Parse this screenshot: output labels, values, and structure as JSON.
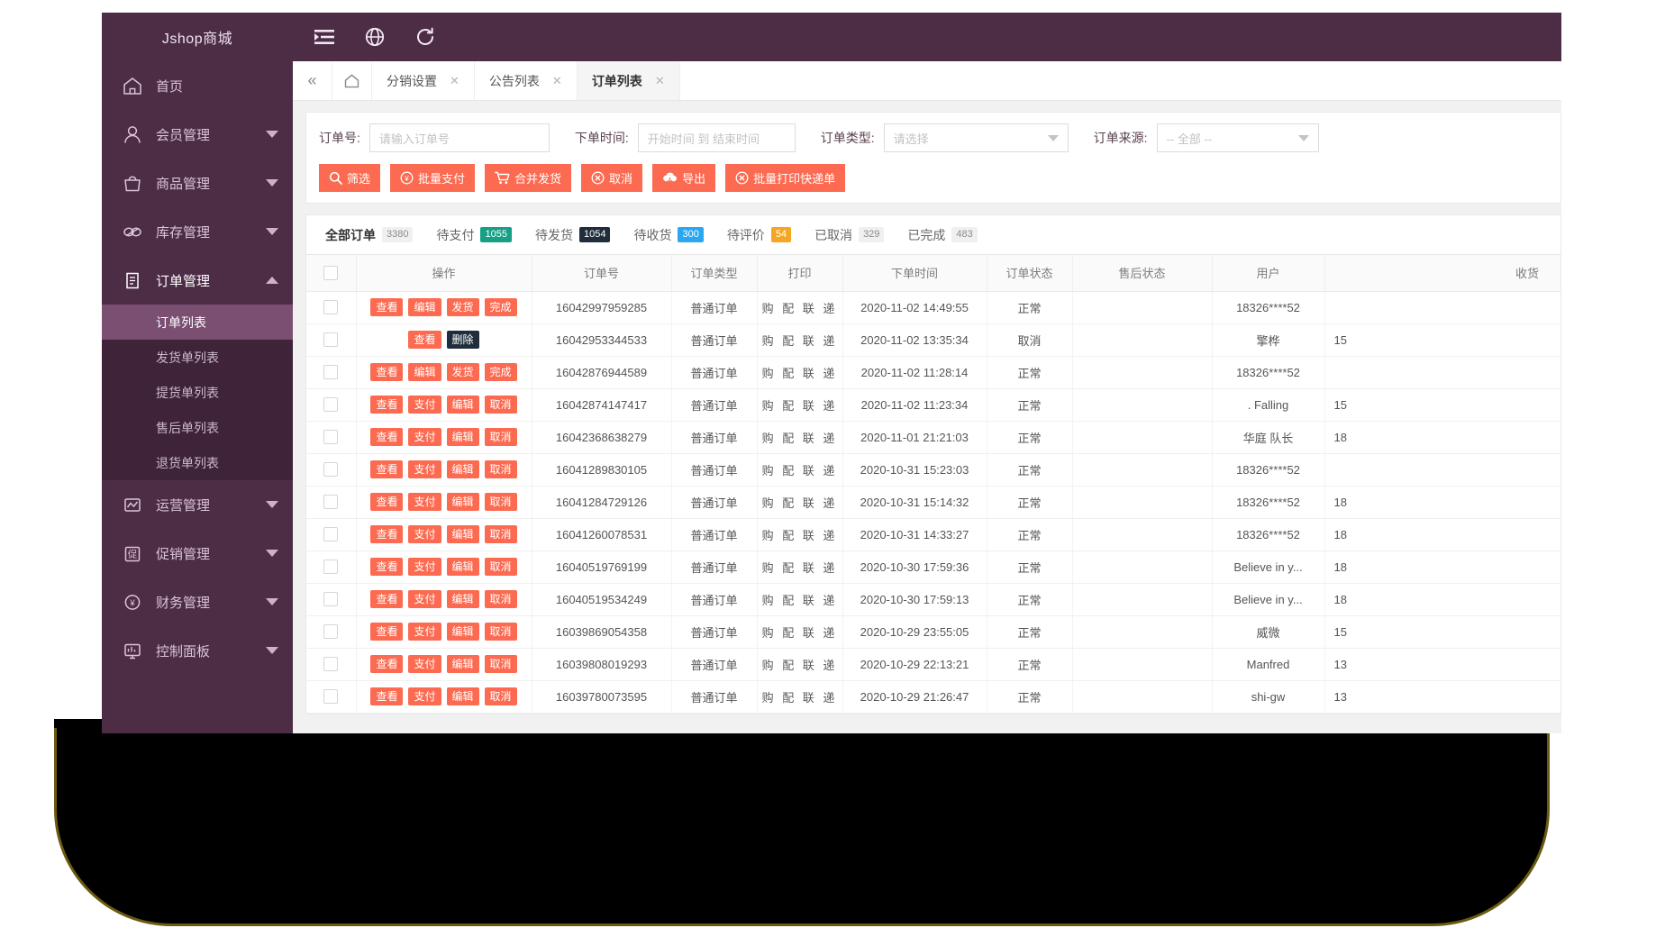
{
  "brand": {
    "title": "Jshop商城"
  },
  "topbar": {
    "icons": [
      {
        "name": "menu-collapse-icon",
        "glyph": "menu"
      },
      {
        "name": "language-globe-icon",
        "glyph": "globe"
      },
      {
        "name": "refresh-icon",
        "glyph": "refresh"
      }
    ]
  },
  "sidebar": {
    "items": [
      {
        "label": "首页",
        "icon": "home-icon",
        "expandable": false
      },
      {
        "label": "会员管理",
        "icon": "user-icon",
        "expandable": true
      },
      {
        "label": "商品管理",
        "icon": "bag-icon",
        "expandable": true
      },
      {
        "label": "库存管理",
        "icon": "link-icon",
        "expandable": true
      },
      {
        "label": "订单管理",
        "icon": "clipboard-icon",
        "expandable": true,
        "open": true
      },
      {
        "label": "运营管理",
        "icon": "chart-board-icon",
        "expandable": true
      },
      {
        "label": "促销管理",
        "icon": "promo-icon",
        "expandable": true
      },
      {
        "label": "财务管理",
        "icon": "finance-icon",
        "expandable": true
      },
      {
        "label": "控制面板",
        "icon": "dashboard-icon",
        "expandable": true
      }
    ],
    "order_submenu": [
      {
        "label": "订单列表",
        "active": true
      },
      {
        "label": "发货单列表",
        "active": false
      },
      {
        "label": "提货单列表",
        "active": false
      },
      {
        "label": "售后单列表",
        "active": false
      },
      {
        "label": "退货单列表",
        "active": false
      }
    ]
  },
  "navtabs": {
    "collapse_glyph": "«",
    "home_glyph": "⌂",
    "tabs": [
      {
        "label": "分销设置",
        "active": false,
        "closable": true
      },
      {
        "label": "公告列表",
        "active": false,
        "closable": true
      },
      {
        "label": "订单列表",
        "active": true,
        "closable": true
      }
    ],
    "close_glyph": "✕"
  },
  "filter": {
    "order_no": {
      "label": "订单号:",
      "placeholder": "请输入订单号",
      "value": ""
    },
    "order_time": {
      "label": "下单时间:",
      "placeholder": "开始时间 到 结束时间",
      "value": ""
    },
    "order_type": {
      "label": "订单类型:",
      "placeholder": "请选择",
      "value": ""
    },
    "order_source": {
      "label": "订单来源:",
      "placeholder": "-- 全部 --",
      "value": ""
    },
    "buttons": [
      {
        "label": "筛选",
        "icon": "search-icon"
      },
      {
        "label": "批量支付",
        "icon": "yuan-circle-icon"
      },
      {
        "label": "合并发货",
        "icon": "cart-icon"
      },
      {
        "label": "取消",
        "icon": "close-circle-icon"
      },
      {
        "label": "导出",
        "icon": "cloud-download-icon"
      },
      {
        "label": "批量打印快递单",
        "icon": "close-circle-icon"
      }
    ],
    "accent_color": "#fc6b51"
  },
  "status_tabs": [
    {
      "label": "全部订单",
      "count": "3380",
      "badge_color": "#f0f0f0",
      "badge_text_color": "#8c8c8c",
      "active": true
    },
    {
      "label": "待支付",
      "count": "1055",
      "badge_color": "#16a085",
      "badge_text_color": "#ffffff",
      "active": false
    },
    {
      "label": "待发货",
      "count": "1054",
      "badge_color": "#1f2d3d",
      "badge_text_color": "#ffffff",
      "active": false
    },
    {
      "label": "待收货",
      "count": "300",
      "badge_color": "#2aa7f0",
      "badge_text_color": "#ffffff",
      "active": false
    },
    {
      "label": "待评价",
      "count": "54",
      "badge_color": "#f5a623",
      "badge_text_color": "#ffffff",
      "active": false
    },
    {
      "label": "已取消",
      "count": "329",
      "badge_color": "#f0f0f0",
      "badge_text_color": "#8c8c8c",
      "active": false
    },
    {
      "label": "已完成",
      "count": "483",
      "badge_color": "#f0f0f0",
      "badge_text_color": "#8c8c8c",
      "active": false
    }
  ],
  "table": {
    "columns": [
      "",
      "操作",
      "订单号",
      "订单类型",
      "打印",
      "下单时间",
      "订单状态",
      "售后状态",
      "用户",
      "收货"
    ],
    "print_cell": "购 配 联 递",
    "rows": [
      {
        "ops": [
          "查看",
          "编辑",
          "发货",
          "完成"
        ],
        "op_styles": [
          "red",
          "red",
          "red",
          "red"
        ],
        "order_no": "16042997959285",
        "type": "普通订单",
        "print": "购 配 联 递",
        "time": "2020-11-02 14:49:55",
        "state": "正常",
        "after": "",
        "user": "18326****52",
        "recv": ""
      },
      {
        "ops": [
          "查看",
          "删除"
        ],
        "op_styles": [
          "red",
          "dark"
        ],
        "order_no": "16042953344533",
        "type": "普通订单",
        "print": "购 配 联 递",
        "time": "2020-11-02 13:35:34",
        "state": "取消",
        "after": "",
        "user": "擎桦",
        "recv": "15"
      },
      {
        "ops": [
          "查看",
          "编辑",
          "发货",
          "完成"
        ],
        "op_styles": [
          "red",
          "red",
          "red",
          "red"
        ],
        "order_no": "16042876944589",
        "type": "普通订单",
        "print": "购 配 联 递",
        "time": "2020-11-02 11:28:14",
        "state": "正常",
        "after": "",
        "user": "18326****52",
        "recv": ""
      },
      {
        "ops": [
          "查看",
          "支付",
          "编辑",
          "取消"
        ],
        "op_styles": [
          "red",
          "red",
          "red",
          "red"
        ],
        "order_no": "16042874147417",
        "type": "普通订单",
        "print": "购 配 联 递",
        "time": "2020-11-02 11:23:34",
        "state": "正常",
        "after": "",
        "user": ". Falling",
        "recv": "15"
      },
      {
        "ops": [
          "查看",
          "支付",
          "编辑",
          "取消"
        ],
        "op_styles": [
          "red",
          "red",
          "red",
          "red"
        ],
        "order_no": "16042368638279",
        "type": "普通订单",
        "print": "购 配 联 递",
        "time": "2020-11-01 21:21:03",
        "state": "正常",
        "after": "",
        "user": "华庭 队长",
        "recv": "18"
      },
      {
        "ops": [
          "查看",
          "支付",
          "编辑",
          "取消"
        ],
        "op_styles": [
          "red",
          "red",
          "red",
          "red"
        ],
        "order_no": "16041289830105",
        "type": "普通订单",
        "print": "购 配 联 递",
        "time": "2020-10-31 15:23:03",
        "state": "正常",
        "after": "",
        "user": "18326****52",
        "recv": ""
      },
      {
        "ops": [
          "查看",
          "支付",
          "编辑",
          "取消"
        ],
        "op_styles": [
          "red",
          "red",
          "red",
          "red"
        ],
        "order_no": "16041284729126",
        "type": "普通订单",
        "print": "购 配 联 递",
        "time": "2020-10-31 15:14:32",
        "state": "正常",
        "after": "",
        "user": "18326****52",
        "recv": "18"
      },
      {
        "ops": [
          "查看",
          "支付",
          "编辑",
          "取消"
        ],
        "op_styles": [
          "red",
          "red",
          "red",
          "red"
        ],
        "order_no": "16041260078531",
        "type": "普通订单",
        "print": "购 配 联 递",
        "time": "2020-10-31 14:33:27",
        "state": "正常",
        "after": "",
        "user": "18326****52",
        "recv": "18"
      },
      {
        "ops": [
          "查看",
          "支付",
          "编辑",
          "取消"
        ],
        "op_styles": [
          "red",
          "red",
          "red",
          "red"
        ],
        "order_no": "16040519769199",
        "type": "普通订单",
        "print": "购 配 联 递",
        "time": "2020-10-30 17:59:36",
        "state": "正常",
        "after": "",
        "user": "Believe in y...",
        "recv": "18"
      },
      {
        "ops": [
          "查看",
          "支付",
          "编辑",
          "取消"
        ],
        "op_styles": [
          "red",
          "red",
          "red",
          "red"
        ],
        "order_no": "16040519534249",
        "type": "普通订单",
        "print": "购 配 联 递",
        "time": "2020-10-30 17:59:13",
        "state": "正常",
        "after": "",
        "user": "Believe in y...",
        "recv": "18"
      },
      {
        "ops": [
          "查看",
          "支付",
          "编辑",
          "取消"
        ],
        "op_styles": [
          "red",
          "red",
          "red",
          "red"
        ],
        "order_no": "16039869054358",
        "type": "普通订单",
        "print": "购 配 联 递",
        "time": "2020-10-29 23:55:05",
        "state": "正常",
        "after": "",
        "user": "威微",
        "recv": "15"
      },
      {
        "ops": [
          "查看",
          "支付",
          "编辑",
          "取消"
        ],
        "op_styles": [
          "red",
          "red",
          "red",
          "red"
        ],
        "order_no": "16039808019293",
        "type": "普通订单",
        "print": "购 配 联 递",
        "time": "2020-10-29 22:13:21",
        "state": "正常",
        "after": "",
        "user": "Manfred",
        "recv": "13"
      },
      {
        "ops": [
          "查看",
          "支付",
          "编辑",
          "取消"
        ],
        "op_styles": [
          "red",
          "red",
          "red",
          "red"
        ],
        "order_no": "16039780073595",
        "type": "普通订单",
        "print": "购 配 联 递",
        "time": "2020-10-29 21:26:47",
        "state": "正常",
        "after": "",
        "user": "shi-gw",
        "recv": "13"
      }
    ]
  }
}
